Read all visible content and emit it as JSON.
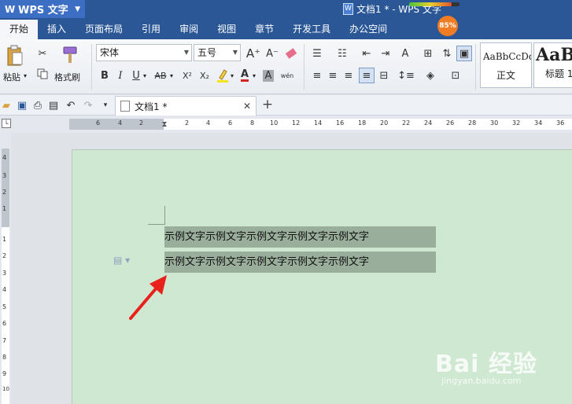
{
  "titlebar": {
    "app_name": "WPS 文字",
    "doc_title": "文档1 * - WPS 文字",
    "memory_badge": "85%"
  },
  "tabs": [
    "开始",
    "插入",
    "页面布局",
    "引用",
    "审阅",
    "视图",
    "章节",
    "开发工具",
    "办公空间"
  ],
  "ribbon": {
    "paste_label": "粘贴",
    "format_painter_label": "格式刷",
    "font_name": "宋体",
    "font_size": "五号",
    "bold": "B",
    "italic": "I",
    "underline": "U",
    "strike": "AB",
    "superscript": "X²",
    "subscript": "X₂",
    "font_color": "A",
    "char_shade": "A",
    "phonetic": "wén",
    "grow_font": "A⁺",
    "shrink_font": "A⁻",
    "styles": [
      {
        "preview": "AaBbCcDd",
        "label": "正文"
      },
      {
        "preview": "AaB",
        "label": "标题 1"
      }
    ]
  },
  "document_tab": {
    "title": "文档1 *",
    "close": "✕",
    "new_tab": "+"
  },
  "ruler": {
    "left_numbers": [
      "6",
      "4",
      "2"
    ],
    "right_numbers": [
      "2",
      "4",
      "6",
      "8",
      "10",
      "12",
      "14",
      "16",
      "18",
      "20",
      "22",
      "24",
      "26",
      "28",
      "30",
      "32",
      "34",
      "36"
    ],
    "vertical_numbers": [
      "4",
      "3",
      "2",
      "1",
      "1",
      "2",
      "3",
      "4",
      "5",
      "6",
      "7",
      "8",
      "9",
      "10"
    ]
  },
  "document": {
    "lines": [
      "示例文字示例文字示例文字示例文字示例文字",
      "示例文字示例文字示例文字示例文字示例文字"
    ]
  },
  "watermark": {
    "brand": "Bai 经验",
    "url": "jingyan.baidu.com"
  },
  "colors": {
    "titlebar": "#2b5797",
    "page": "#cfe8d1",
    "selection": "#9aae9c",
    "arrow": "#e8211d"
  }
}
